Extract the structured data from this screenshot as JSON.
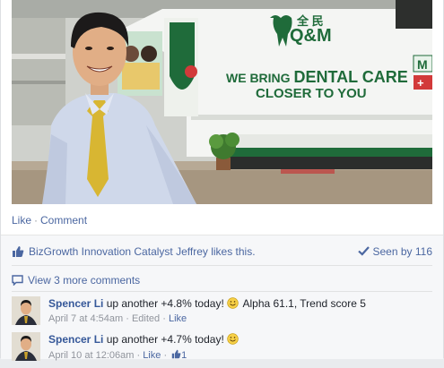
{
  "post": {
    "photo": {
      "truck_chinese": "全 民",
      "truck_brand": "Q&M",
      "truck_slogan_line1_part1": "WE BRING ",
      "truck_slogan_line1_part2": "DENTAL CARE",
      "truck_slogan_line2": "CLOSER TO YOU",
      "truck_side_tag": "M",
      "truck_side_plus": "+"
    },
    "actions": {
      "like_label": "Like",
      "separator": "·",
      "comment_label": "Comment"
    }
  },
  "ufi": {
    "likes_sentence": "BizGrowth Innovation Catalyst Jeffrey likes this.",
    "seen_label": "Seen by 116",
    "view_more": "View 3 more comments",
    "comments": [
      {
        "author": "Spencer Li",
        "text_before": " up another +4.8% today!",
        "text_after": " Alpha 61.1, Trend score 5",
        "timestamp": "April 7 at 4:54am",
        "sep1": "·",
        "edited": "Edited",
        "sep2": "·",
        "like_label": "Like",
        "like_count": ""
      },
      {
        "author": "Spencer Li",
        "text_before": " up another +4.7% today!",
        "text_after": "",
        "timestamp": "April 10 at 12:06am",
        "sep1": "·",
        "edited": "",
        "sep2": "·",
        "like_label": "Like",
        "like_count": "1"
      }
    ]
  },
  "colors": {
    "link": "#4b67a1",
    "author": "#365899",
    "meta": "#90949c",
    "truck_green": "#1f6b3a"
  }
}
